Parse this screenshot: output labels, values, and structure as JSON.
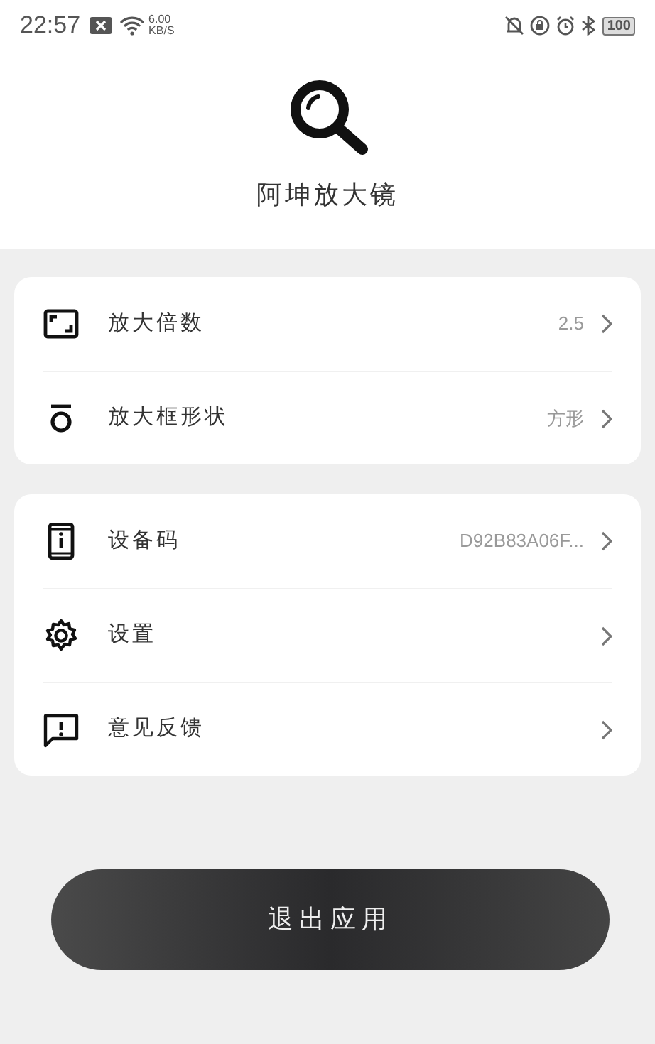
{
  "status_bar": {
    "time": "22:57",
    "speed_value": "6.00",
    "speed_unit": "KB/S",
    "battery": "100"
  },
  "app": {
    "title": "阿坤放大镜"
  },
  "groups": [
    {
      "items": [
        {
          "kind": "scale",
          "label": "放大倍数",
          "value": "2.5"
        },
        {
          "kind": "shape",
          "label": "放大框形状",
          "value": "方形"
        }
      ]
    },
    {
      "items": [
        {
          "kind": "device",
          "label": "设备码",
          "value": "D92B83A06F..."
        },
        {
          "kind": "settings",
          "label": "设置"
        },
        {
          "kind": "feedback",
          "label": "意见反馈"
        }
      ]
    }
  ],
  "exit_button": {
    "label": "退出应用"
  }
}
